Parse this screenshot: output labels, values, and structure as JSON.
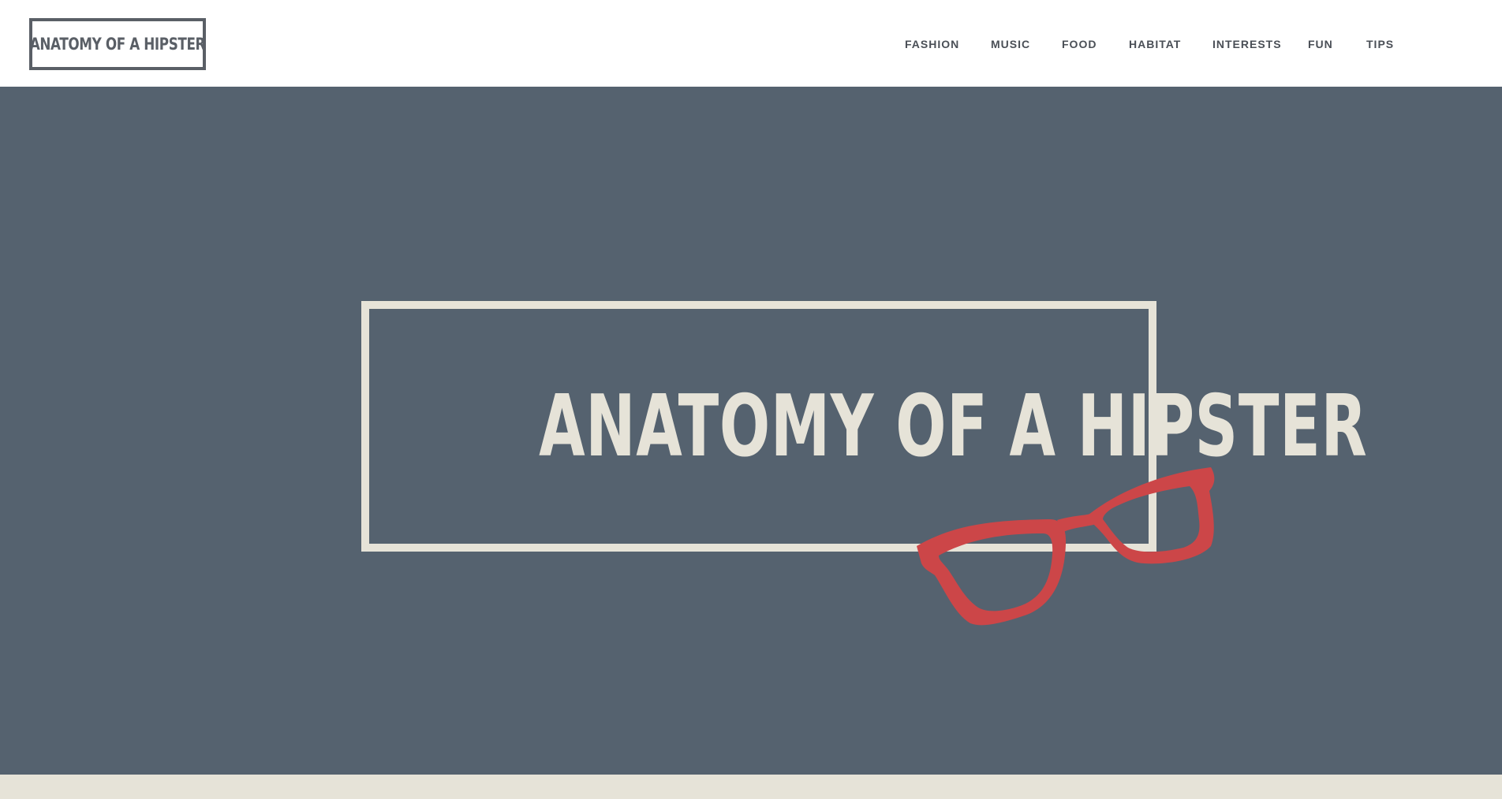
{
  "header": {
    "logo_text": "ANATOMY OF A HIPSTER",
    "nav": [
      {
        "label": "FASHION"
      },
      {
        "label": "MUSIC"
      },
      {
        "label": "FOOD"
      },
      {
        "label": "HABITAT"
      },
      {
        "label": "INTERESTS"
      },
      {
        "label": "FUN"
      },
      {
        "label": "TIPS"
      }
    ]
  },
  "hero": {
    "title": "ANATOMY OF A HIPSTER",
    "illustration": "red-glasses-icon"
  },
  "colors": {
    "header_bg": "#ffffff",
    "hero_bg": "#55626f",
    "cream": "#e6e3d8",
    "logo_gray": "#5a5f66",
    "glasses_red": "#cc4648"
  }
}
